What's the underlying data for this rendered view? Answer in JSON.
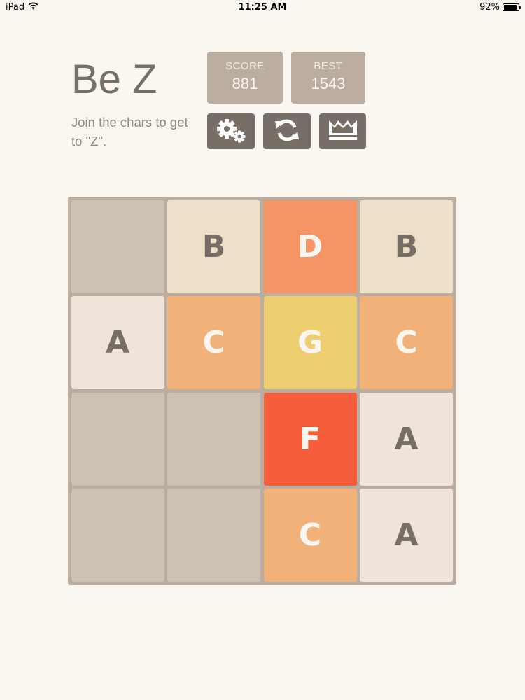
{
  "status": {
    "device": "iPad",
    "time": "11:25 AM",
    "battery": "92%",
    "battery_level": 0.92
  },
  "header": {
    "title": "Be Z",
    "subtitle": "Join the chars to get to \"Z\"."
  },
  "scores": {
    "score_label": "SCORE",
    "score_value": "881",
    "best_label": "BEST",
    "best_value": "1543"
  },
  "buttons": {
    "settings_icon": "gears-icon",
    "restart_icon": "refresh-icon",
    "leaderboard_icon": "crown-icon"
  },
  "colors": {
    "background": "#faf7f0",
    "board": "#bbada0",
    "empty_cell": "#cdc1b4",
    "button": "#776e65"
  },
  "tile_styles": {
    "A": {
      "bg": "#eee4da",
      "fg": "#776e65"
    },
    "B": {
      "bg": "#ede0c8",
      "fg": "#776e65"
    },
    "C": {
      "bg": "#f2b179",
      "fg": "#f9f6f2"
    },
    "D": {
      "bg": "#f59563",
      "fg": "#f9f6f2"
    },
    "F": {
      "bg": "#f65e3b",
      "fg": "#f9f6f2"
    },
    "G": {
      "bg": "#edcf72",
      "fg": "#f9f6f2"
    }
  },
  "board": {
    "rows": [
      [
        "",
        "B",
        "D",
        "B"
      ],
      [
        "A",
        "C",
        "G",
        "C"
      ],
      [
        "",
        "",
        "F",
        "A"
      ],
      [
        "",
        "",
        "C",
        "A"
      ]
    ]
  }
}
